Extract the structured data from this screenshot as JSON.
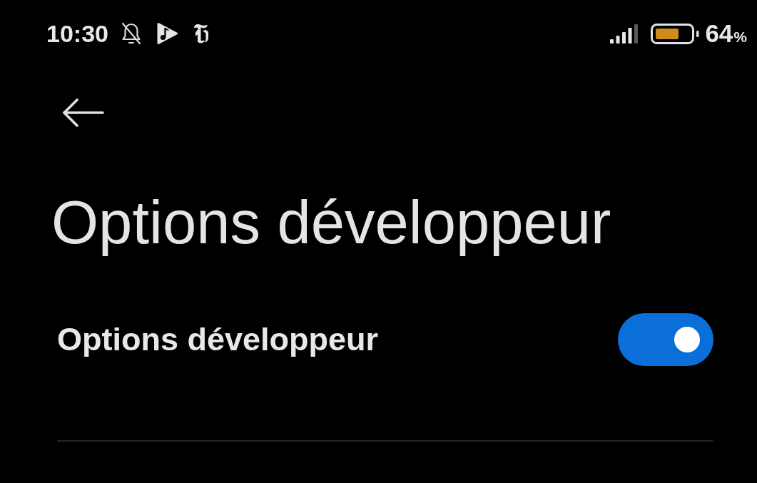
{
  "status_bar": {
    "time": "10:30",
    "battery_percent": "64",
    "battery_unit": "%"
  },
  "title": "Options développeur",
  "settings": [
    {
      "kind": "toggle",
      "label": "Options développeur",
      "on": true
    }
  ]
}
